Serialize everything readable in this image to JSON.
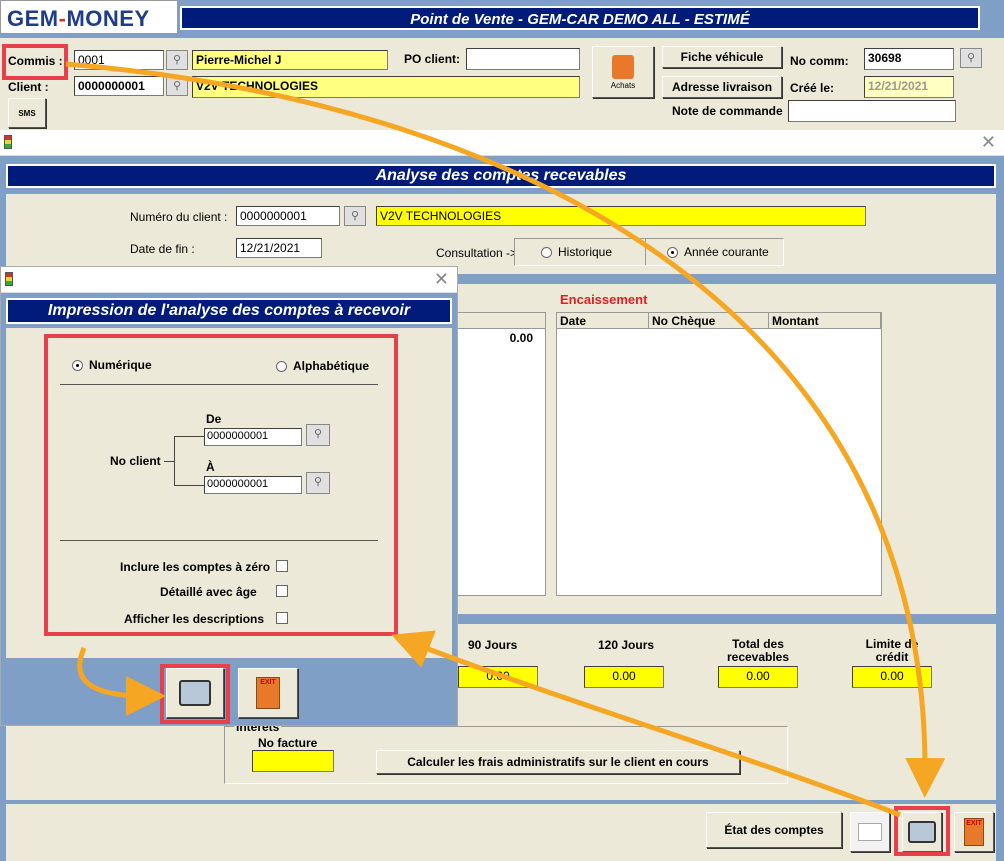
{
  "app": {
    "logo": "GEM-MONEY",
    "title": "Point de Vente - GEM-CAR DEMO ALL  - ESTIMÉ"
  },
  "header": {
    "commis_label": "Commis :",
    "commis_code": "0001",
    "commis_name": "Pierre-Michel J",
    "client_label": "Client :",
    "client_code": "0000000001",
    "client_name": "V2V TECHNOLOGIES",
    "po_label": "PO client:",
    "po_value": "",
    "achats_label": "Achats",
    "fiche_btn": "Fiche véhicule",
    "adresse_btn": "Adresse livraison",
    "nocomm_label": "No comm:",
    "nocomm_value": "30698",
    "cree_label": "Créé le:",
    "cree_value": "12/21/2021",
    "note_label": "Note de commande",
    "sms_label": "SMS"
  },
  "analysis": {
    "title": "Analyse des comptes recevables",
    "client_num_label": "Numéro du client :",
    "client_num": "0000000001",
    "client_name": "V2V TECHNOLOGIES",
    "date_label": "Date de fin :",
    "date_value": "12/21/2021",
    "consult_label": "Consultation ->",
    "radio_hist": "Historique",
    "radio_annee": "Année courante",
    "left_value": "0.00",
    "encaissement_title": "Encaissement",
    "enc_cols": [
      "Date",
      "No Chèque",
      "Montant"
    ],
    "aging": [
      {
        "label": "90 Jours",
        "value": "0.00"
      },
      {
        "label": "120 Jours",
        "value": "0.00"
      },
      {
        "label": "Total des recevables",
        "value": "0.00"
      },
      {
        "label": "Limite de crédit",
        "value": "0.00"
      }
    ],
    "interets_label": "Intérêts",
    "nofacture_label": "No facture",
    "nofacture_value": "",
    "calc_btn": "Calculer les frais administratifs sur le client en cours",
    "etat_btn": "État des comptes"
  },
  "print_dialog": {
    "title": "Impression de l'analyse des comptes à recevoir",
    "radio_num": "Numérique",
    "radio_alpha": "Alphabétique",
    "de_label": "De",
    "a_label": "À",
    "noclient_label": "No client",
    "from_value": "0000000001",
    "to_value": "0000000001",
    "opt1": "Inclure les comptes à zéro",
    "opt2": "Détaillé avec âge",
    "opt3": "Afficher les descriptions",
    "exit_label": "EXIT"
  },
  "colors": {
    "accent_blue": "#001b7a",
    "highlight_red": "#e8404a",
    "arrow_orange": "#f5a623",
    "field_yellow": "#ffff00"
  }
}
